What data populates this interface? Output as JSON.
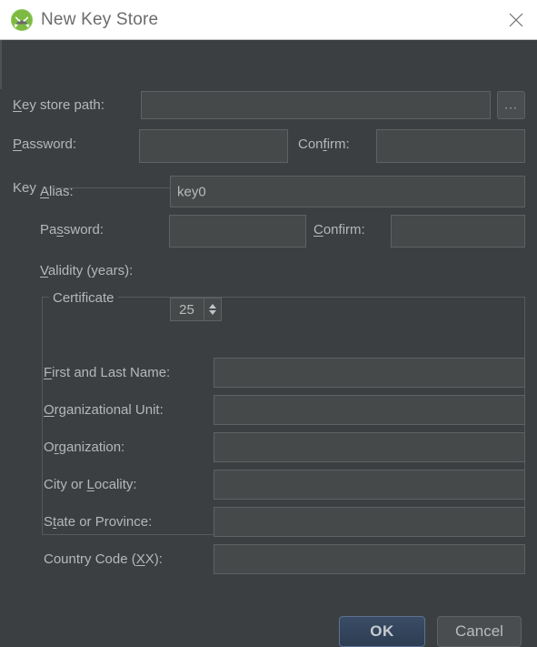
{
  "window": {
    "title": "New Key Store",
    "icon": "android-studio-icon",
    "close_label": "close-icon",
    "title_bar_bg": "#ffffff",
    "dialog_bg": "#3c3f41"
  },
  "keystore": {
    "path": {
      "label_pre": "",
      "label_mnemonic": "K",
      "label_post": "ey store path:",
      "value": "",
      "browse_label": "..."
    },
    "password": {
      "label_pre": "",
      "label_mnemonic": "P",
      "label_post": "assword:",
      "value": ""
    },
    "confirm": {
      "label_pre": "Con",
      "label_mnemonic": "f",
      "label_post": "irm:",
      "value": ""
    }
  },
  "key_group": {
    "title": "Key",
    "alias": {
      "label_pre": "",
      "label_mnemonic": "A",
      "label_post": "lias:",
      "value": "key0"
    },
    "password": {
      "label_pre": "Pa",
      "label_mnemonic": "s",
      "label_post": "sword:",
      "value": ""
    },
    "confirm": {
      "label_pre": "",
      "label_mnemonic": "C",
      "label_post": "onfirm:",
      "value": ""
    },
    "validity": {
      "label_pre": "",
      "label_mnemonic": "V",
      "label_post": "alidity (years):",
      "value": "25"
    }
  },
  "certificate": {
    "title": "Certificate",
    "fields": [
      {
        "name": "first-and-last-name",
        "label_pre": "",
        "label_mnemonic": "F",
        "label_post": "irst and Last Name:",
        "value": ""
      },
      {
        "name": "organizational-unit",
        "label_pre": "",
        "label_mnemonic": "O",
        "label_post": "rganizational Unit:",
        "value": ""
      },
      {
        "name": "organization",
        "label_pre": "O",
        "label_mnemonic": "r",
        "label_post": "ganization:",
        "value": ""
      },
      {
        "name": "city-or-locality",
        "label_pre": "City or ",
        "label_mnemonic": "L",
        "label_post": "ocality:",
        "value": ""
      },
      {
        "name": "state-or-province",
        "label_pre": "S",
        "label_mnemonic": "t",
        "label_post": "ate or Province:",
        "value": ""
      },
      {
        "name": "country-code",
        "label_pre": "Country Code (",
        "label_mnemonic": "X",
        "label_post": "X):",
        "value": ""
      }
    ]
  },
  "footer": {
    "ok_label": "OK",
    "cancel_label": "Cancel",
    "ok_accent": "#3a4d66"
  }
}
